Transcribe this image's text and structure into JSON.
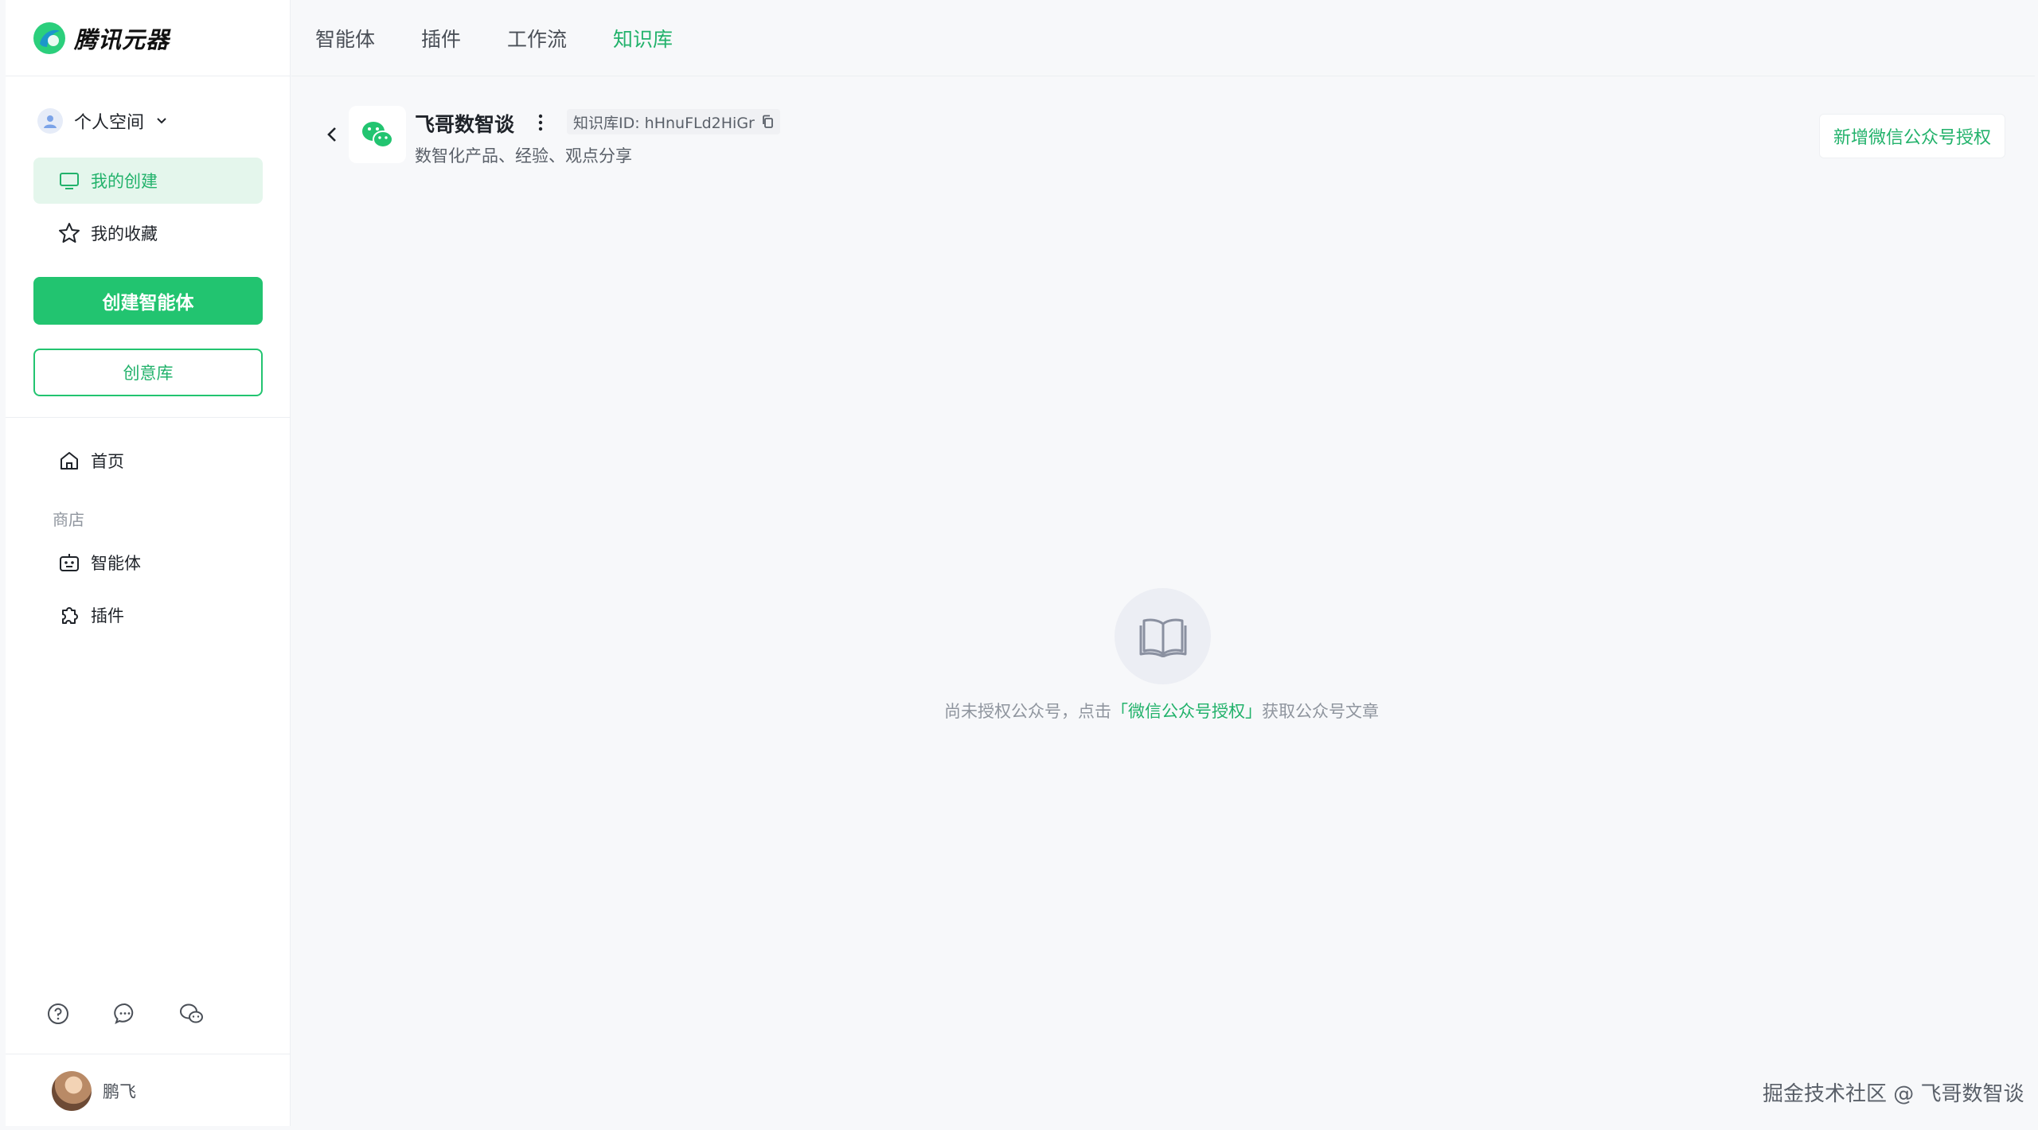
{
  "app": {
    "logo_text": "腾讯元器"
  },
  "sidebar": {
    "space_label": "个人空间",
    "items_top": [
      {
        "label": "我的创建",
        "icon": "monitor-icon",
        "active": true
      },
      {
        "label": "我的收藏",
        "icon": "star-icon",
        "active": false
      }
    ],
    "create_button": "创建智能体",
    "idea_button": "创意库",
    "home_label": "首页",
    "section_label": "商店",
    "items_store": [
      {
        "label": "智能体",
        "icon": "robot-icon"
      },
      {
        "label": "插件",
        "icon": "puzzle-icon"
      }
    ],
    "bottom_icons": [
      "help-icon",
      "chat-icon",
      "wechat-icon"
    ],
    "user_name": "鹏飞"
  },
  "topnav": {
    "tabs": [
      {
        "label": "智能体",
        "active": false
      },
      {
        "label": "插件",
        "active": false
      },
      {
        "label": "工作流",
        "active": false
      },
      {
        "label": "知识库",
        "active": true
      }
    ]
  },
  "kb": {
    "title": "飞哥数智谈",
    "id_text": "知识库ID: hHnuFLd2HiGr",
    "description": "数智化产品、经验、观点分享",
    "auth_button": "新增微信公众号授权"
  },
  "empty_state": {
    "prefix": "尚未授权公众号，点击",
    "link": "「微信公众号授权」",
    "suffix": "获取公众号文章"
  },
  "watermark": "掘金技术社区 @ 飞哥数智谈",
  "colors": {
    "accent": "#22c470",
    "accent_text": "#22b26b",
    "background": "#f7f8fa"
  }
}
